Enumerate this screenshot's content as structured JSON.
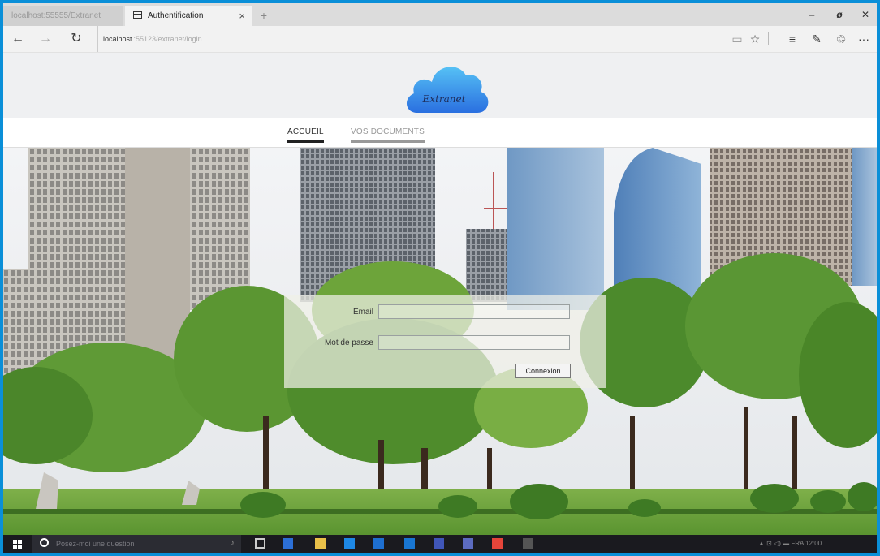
{
  "browser": {
    "inactive_tab": "localhost:55555/Extranet",
    "active_tab": "Authentification",
    "new_tab_label": "+",
    "tab_close": "×",
    "window_controls": [
      "–",
      "❐",
      "✕"
    ],
    "nav": {
      "back": "←",
      "forward": "→",
      "refresh": "↻"
    },
    "url_host": "localhost",
    "url_path": ":55123/extranet/login",
    "tools": [
      "▭",
      "☆",
      "≡",
      "✎",
      "♲",
      "···"
    ]
  },
  "site": {
    "logo_text": "Extranet",
    "nav": [
      {
        "label": "ACCUEIL",
        "active": true
      },
      {
        "label": "VOS DOCUMENTS",
        "active": false
      }
    ]
  },
  "login": {
    "email_label": "Email",
    "email_value": "",
    "password_label": "Mot de passe",
    "password_value": "",
    "submit_label": "Connexion"
  },
  "taskbar": {
    "search_placeholder": "Posez-moi une question",
    "tray": "▲ ⊡ ◁) ▬  FRA  12:00"
  },
  "colors": {
    "windows_frame": "#0a8fd8",
    "header_bg": "#eff0f2",
    "cloud_blue": "#2f8be6",
    "taskbar": "#1a1a1f"
  }
}
